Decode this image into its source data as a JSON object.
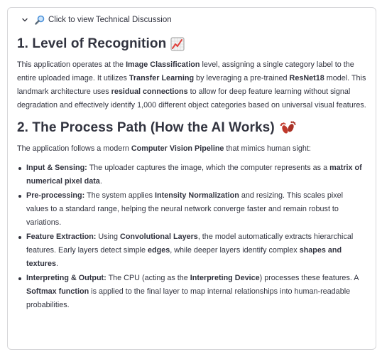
{
  "expander": {
    "label": "Click to view Technical Discussion"
  },
  "section1": {
    "title": "1. Level of Recognition",
    "paragraph": [
      {
        "t": "This application operates at the "
      },
      {
        "b": "Image Classification"
      },
      {
        "t": " level, assigning a single category label to the entire uploaded image. It utilizes "
      },
      {
        "b": "Transfer Learning"
      },
      {
        "t": " by leveraging a pre-trained "
      },
      {
        "b": "ResNet18"
      },
      {
        "t": " model. This landmark architecture uses "
      },
      {
        "b": "residual connections"
      },
      {
        "t": " to allow for deep feature learning without signal degradation and effectively identify 1,000 different object categories based on universal visual features."
      }
    ]
  },
  "section2": {
    "title": "2. The Process Path (How the AI Works)",
    "intro": [
      {
        "t": "The application follows a modern "
      },
      {
        "b": "Computer Vision Pipeline"
      },
      {
        "t": " that mimics human sight:"
      }
    ],
    "bullets": [
      [
        {
          "b": "Input & Sensing:"
        },
        {
          "t": " The uploader captures the image, which the computer represents as a "
        },
        {
          "b": "matrix of numerical pixel data"
        },
        {
          "t": "."
        }
      ],
      [
        {
          "b": "Pre-processing:"
        },
        {
          "t": " The system applies "
        },
        {
          "b": "Intensity Normalization"
        },
        {
          "t": " and resizing. This scales pixel values to a standard range, helping the neural network converge faster and remain robust to variations."
        }
      ],
      [
        {
          "b": "Feature Extraction:"
        },
        {
          "t": " Using "
        },
        {
          "b": "Convolutional Layers"
        },
        {
          "t": ", the model automatically extracts hierarchical features. Early layers detect simple "
        },
        {
          "b": "edges"
        },
        {
          "t": ", while deeper layers identify complex "
        },
        {
          "b": "shapes and textures"
        },
        {
          "t": "."
        }
      ],
      [
        {
          "b": "Interpreting & Output:"
        },
        {
          "t": " The CPU (acting as the "
        },
        {
          "b": "Interpreting Device"
        },
        {
          "t": ") processes these features. A "
        },
        {
          "b": "Softmax function"
        },
        {
          "t": " is applied to the final layer to map internal relationships into human-readable probabilities."
        }
      ]
    ]
  },
  "icons": {
    "expander_chevron": "chevron-down-icon",
    "expander_search": "magnifying-glass-icon",
    "section1_emoji": "chart-increasing-icon",
    "section2_emoji": "footprints-icon"
  },
  "colors": {
    "text": "#31333f",
    "border": "#d6d6d9",
    "chart_line": "#e0403a",
    "footprints": "#c0392b",
    "magnifier": "#4a90d9"
  }
}
